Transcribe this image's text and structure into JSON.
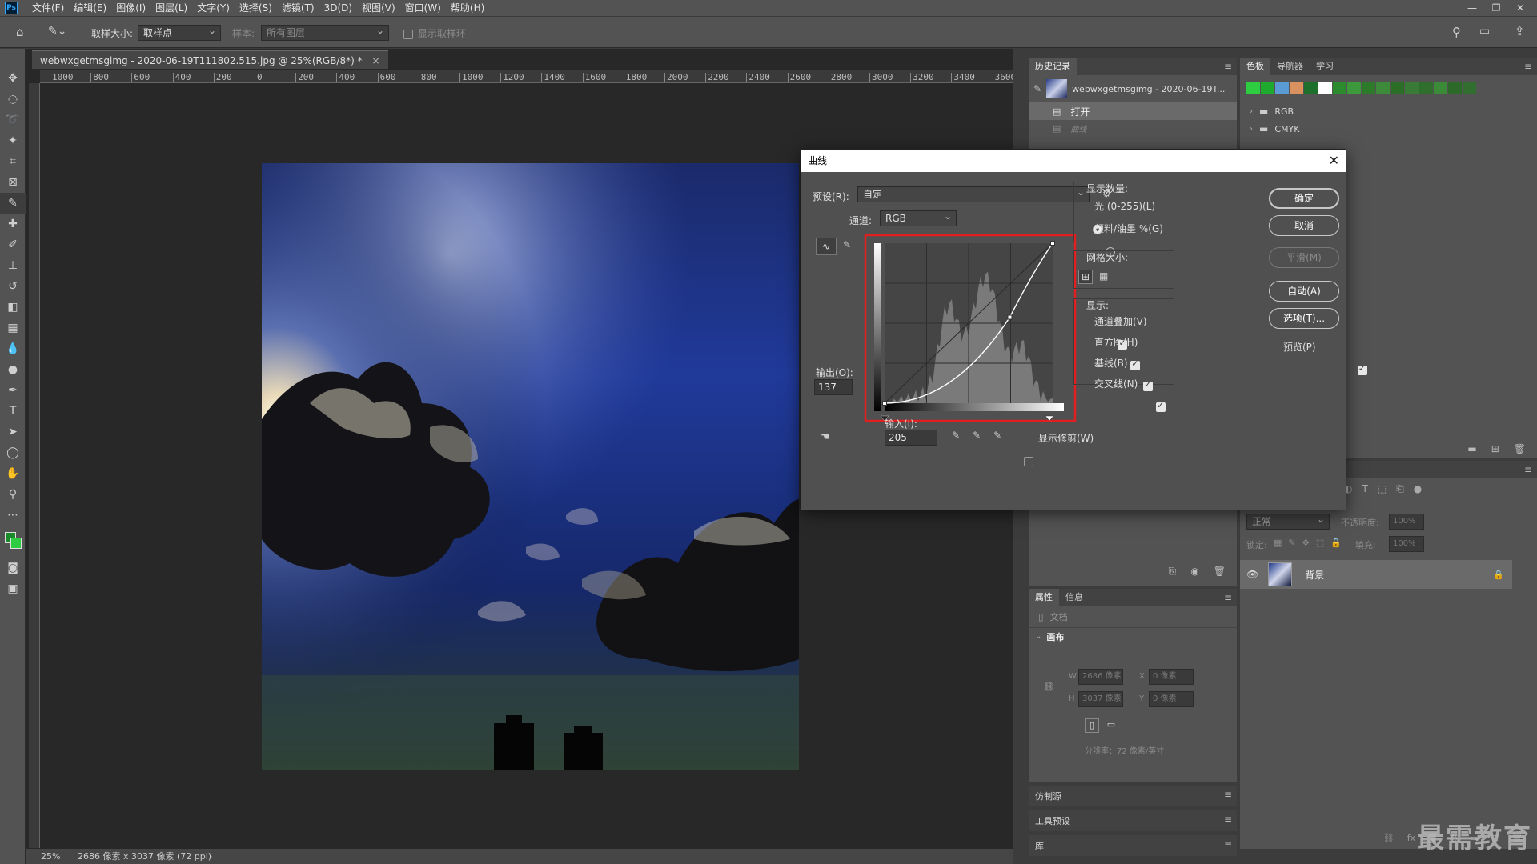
{
  "app": {
    "logo": "Ps",
    "menus": [
      "文件(F)",
      "编辑(E)",
      "图像(I)",
      "图层(L)",
      "文字(Y)",
      "选择(S)",
      "滤镜(T)",
      "3D(D)",
      "视图(V)",
      "窗口(W)",
      "帮助(H)"
    ],
    "window_controls": [
      "—",
      "❐",
      "✕"
    ]
  },
  "options": {
    "sample_size_label": "取样大小:",
    "sample_size_value": "取样点",
    "sample_label": "样本:",
    "sample_value": "所有图层",
    "show_ring_label": "显示取样环"
  },
  "document": {
    "tab_title": "webwxgetmsgimg - 2020-06-19T111802.515.jpg @ 25%(RGB/8*) *",
    "ruler_ticks": [
      "1000",
      "800",
      "600",
      "400",
      "200",
      "0",
      "200",
      "400",
      "600",
      "800",
      "1000",
      "1200",
      "1400",
      "1600",
      "1800",
      "2000",
      "2200",
      "2400",
      "2600",
      "2800",
      "3000",
      "3200",
      "3400",
      "3600"
    ],
    "zoom": "25%",
    "status": "2686 像素 x 3037 像素 (72 ppi)"
  },
  "history": {
    "tab": "历史记录",
    "snapshot": "webwxgetmsgimg - 2020-06-19T...",
    "items": [
      "打开",
      "曲线"
    ]
  },
  "swatches": {
    "tabs": [
      "色板",
      "导航器",
      "学习"
    ],
    "colors": [
      "#2ecc40",
      "#1faa2e",
      "#5b9bd5",
      "#d9925f",
      "#1e6e2c",
      "#ffffff",
      "#2c8a2f",
      "#3c9a3c",
      "#2c7a2a",
      "#3d8a3b",
      "#2a6e28",
      "#3a7a37",
      "#2f6e2d",
      "#3a8a38",
      "#2b6a29",
      "#336e31"
    ],
    "folders": [
      "RGB",
      "CMYK"
    ]
  },
  "layers": {
    "blend_mode": "正常",
    "opacity_label": "不透明度:",
    "opacity_value": "100%",
    "lock_label": "锁定:",
    "fill_label": "填充:",
    "fill_value": "100%",
    "layer_name": "背景"
  },
  "properties": {
    "tabs": [
      "属性",
      "信息"
    ],
    "doc_label": "文档",
    "canvas_label": "画布",
    "w_label": "W",
    "w_value": "2686 像素",
    "h_label": "H",
    "h_value": "3037 像素",
    "x_label": "X",
    "x_value": "0 像素",
    "y_label": "Y",
    "y_value": "0 像素",
    "resolution": "分辨率：72 像素/英寸"
  },
  "collapsed_panels": [
    "仿制源",
    "工具预设",
    "库"
  ],
  "watermark": "最需教育",
  "curves": {
    "title": "曲线",
    "preset_label": "预设(R):",
    "preset_value": "自定",
    "channel_label": "通道:",
    "channel_value": "RGB",
    "output_label": "输出(O):",
    "output_value": "137",
    "input_label": "输入(I):",
    "input_value": "205",
    "show_clipping_label": "显示修剪(W)",
    "show_amount_label": "显示数量:",
    "light_label": "光 (0-255)(L)",
    "pigment_label": "颜料/油墨 %(G)",
    "grid_size_label": "网格大小:",
    "show_label": "显示:",
    "channel_overlay_label": "通道叠加(V)",
    "histogram_label": "直方图(H)",
    "baseline_label": "基线(B)",
    "intersection_label": "交叉线(N)",
    "ok_label": "确定",
    "cancel_label": "取消",
    "smooth_label": "平滑(M)",
    "auto_label": "自动(A)",
    "options_label": "选项(T)...",
    "preview_label": "预览(P)",
    "highlight_color": "#e02020",
    "curve_points": [
      [
        0,
        0
      ],
      [
        190,
        137
      ],
      [
        255,
        255
      ]
    ]
  }
}
